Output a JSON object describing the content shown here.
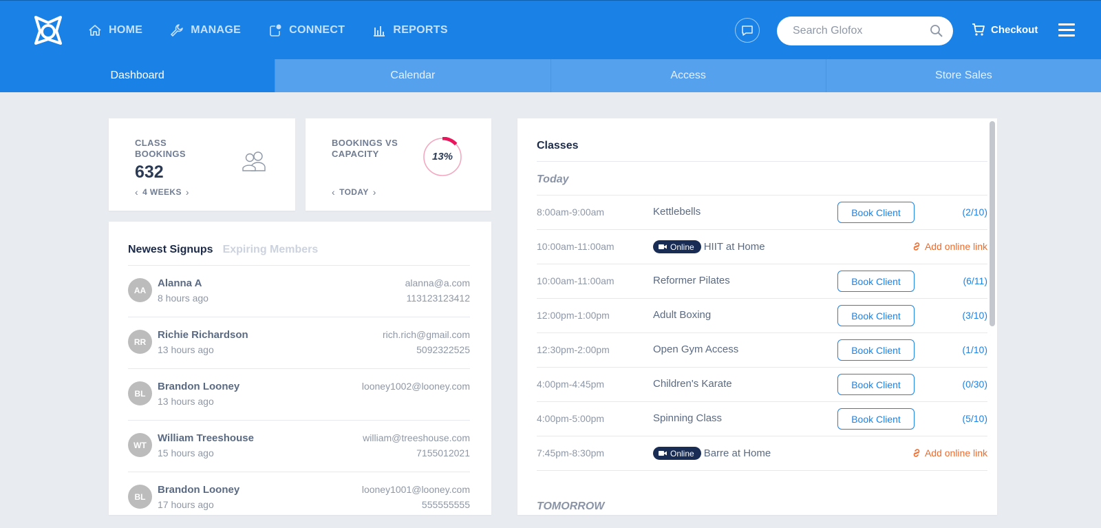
{
  "nav": {
    "items": [
      {
        "label": "HOME",
        "icon": "home-icon"
      },
      {
        "label": "MANAGE",
        "icon": "wrench-icon"
      },
      {
        "label": "CONNECT",
        "icon": "connect-icon"
      },
      {
        "label": "REPORTS",
        "icon": "bar-chart-icon"
      }
    ],
    "search_placeholder": "Search Glofox",
    "checkout_label": "Checkout"
  },
  "tabs": [
    "Dashboard",
    "Calendar",
    "Access",
    "Store Sales"
  ],
  "stats": {
    "class_bookings": {
      "label": "CLASS BOOKINGS",
      "value": "632",
      "period": "4 WEEKS"
    },
    "bookings_vs_capacity": {
      "label": "BOOKINGS VS CAPACITY",
      "value": "13%",
      "percent": 13,
      "period": "TODAY"
    }
  },
  "signups": {
    "tab_active": "Newest Signups",
    "tab_inactive": "Expiring Members",
    "rows": [
      {
        "initials": "AA",
        "name": "Alanna A",
        "time": "8 hours ago",
        "email": "alanna@a.com",
        "phone": "113123123412"
      },
      {
        "initials": "RR",
        "name": "Richie Richardson",
        "time": "13 hours ago",
        "email": "rich.rich@gmail.com",
        "phone": "5092322525"
      },
      {
        "initials": "BL",
        "name": "Brandon Looney",
        "time": "13 hours ago",
        "email": "looney1002@looney.com",
        "phone": ""
      },
      {
        "initials": "WT",
        "name": "William Treeshouse",
        "time": "15 hours ago",
        "email": "william@treeshouse.com",
        "phone": "7155012021"
      },
      {
        "initials": "BL",
        "name": "Brandon Looney",
        "time": "17 hours ago",
        "email": "looney1001@looney.com",
        "phone": "555555555"
      }
    ]
  },
  "classes": {
    "title": "Classes",
    "today_label": "Today",
    "tomorrow_label": "TOMORROW",
    "book_label": "Book Client",
    "online_label": "Online",
    "add_link_label": "Add online link",
    "rows": [
      {
        "time": "8:00am-9:00am",
        "name": "Kettlebells",
        "online": false,
        "count": "(2/10)"
      },
      {
        "time": "10:00am-11:00am",
        "name": "HIIT at Home",
        "online": true,
        "count": ""
      },
      {
        "time": "10:00am-11:00am",
        "name": "Reformer Pilates",
        "online": false,
        "count": "(6/11)"
      },
      {
        "time": "12:00pm-1:00pm",
        "name": "Adult Boxing",
        "online": false,
        "count": "(3/10)"
      },
      {
        "time": "12:30pm-2:00pm",
        "name": "Open Gym Access",
        "online": false,
        "count": "(1/10)"
      },
      {
        "time": "4:00pm-4:45pm",
        "name": "Children's Karate",
        "online": false,
        "count": "(0/30)"
      },
      {
        "time": "4:00pm-5:00pm",
        "name": "Spinning Class",
        "online": false,
        "count": "(5/10)"
      },
      {
        "time": "7:45pm-8:30pm",
        "name": "Barre at Home",
        "online": true,
        "count": ""
      }
    ]
  },
  "colors": {
    "primary": "#1a82e6",
    "tab_bar": "#55a1ee",
    "accent_red": "#e8175d",
    "link_orange": "#f06a2a",
    "badge_navy": "#182c54"
  }
}
